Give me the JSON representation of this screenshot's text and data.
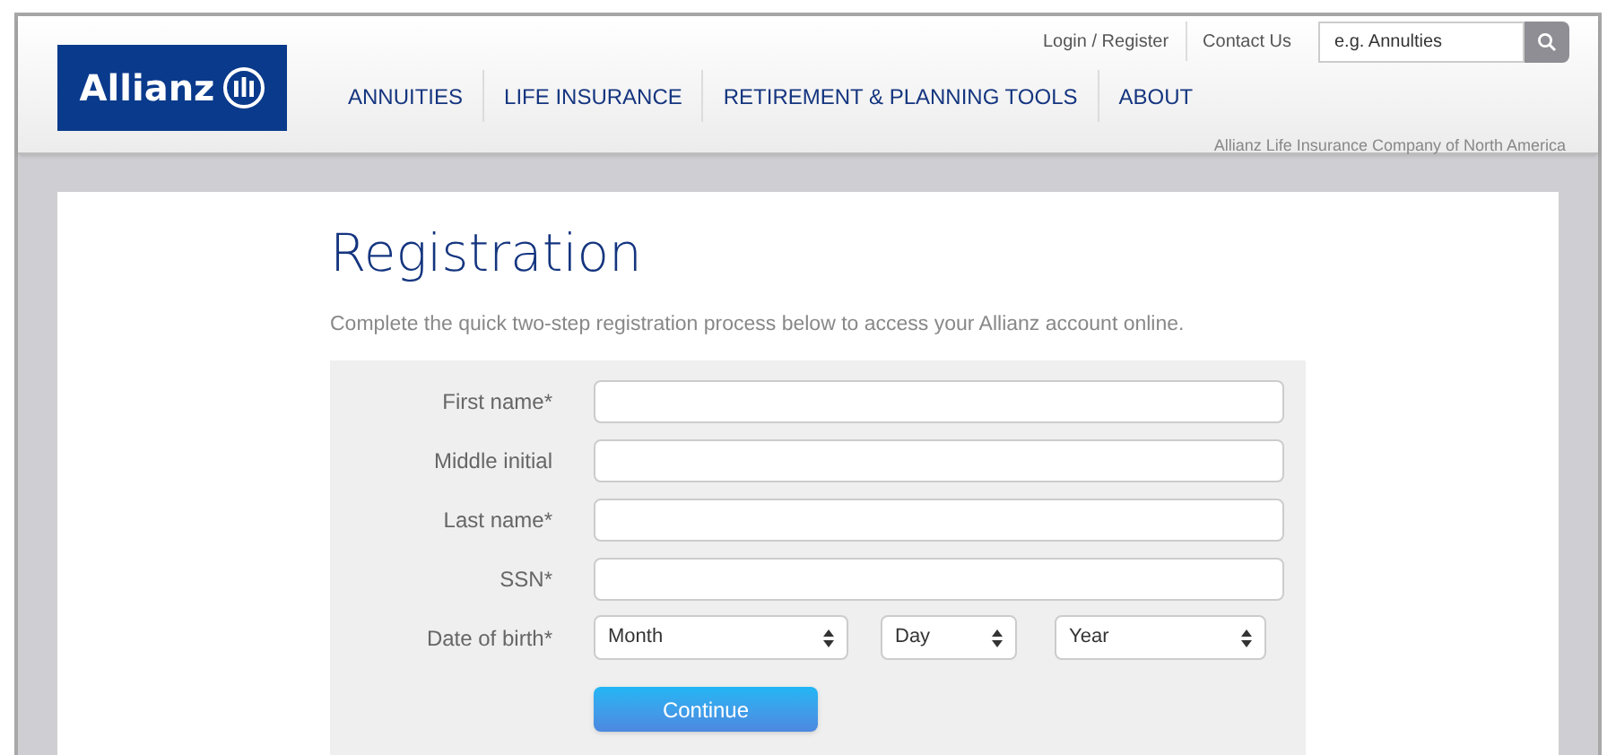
{
  "header": {
    "logo": "Allianz",
    "top_links": [
      "Login / Register",
      "Contact Us"
    ],
    "search": {
      "placeholder": "e.g. Annulties"
    },
    "nav": [
      "ANNUITIES",
      "LIFE INSURANCE",
      "RETIREMENT & PLANNING TOOLS",
      "ABOUT"
    ],
    "tagline": "Allianz Life Insurance Company of North America"
  },
  "page": {
    "title": "Registration",
    "intro": "Complete the quick two-step registration process below to access your Allianz account online.",
    "fields": [
      {
        "kind": "text",
        "label": "First name*"
      },
      {
        "kind": "text",
        "label": "Middle initial"
      },
      {
        "kind": "text",
        "label": "Last name*"
      },
      {
        "kind": "text",
        "label": "SSN*"
      },
      {
        "kind": "date",
        "label": "Date of birth*",
        "selects": [
          "Month",
          "Day",
          "Year"
        ]
      }
    ],
    "button": "Continue"
  }
}
